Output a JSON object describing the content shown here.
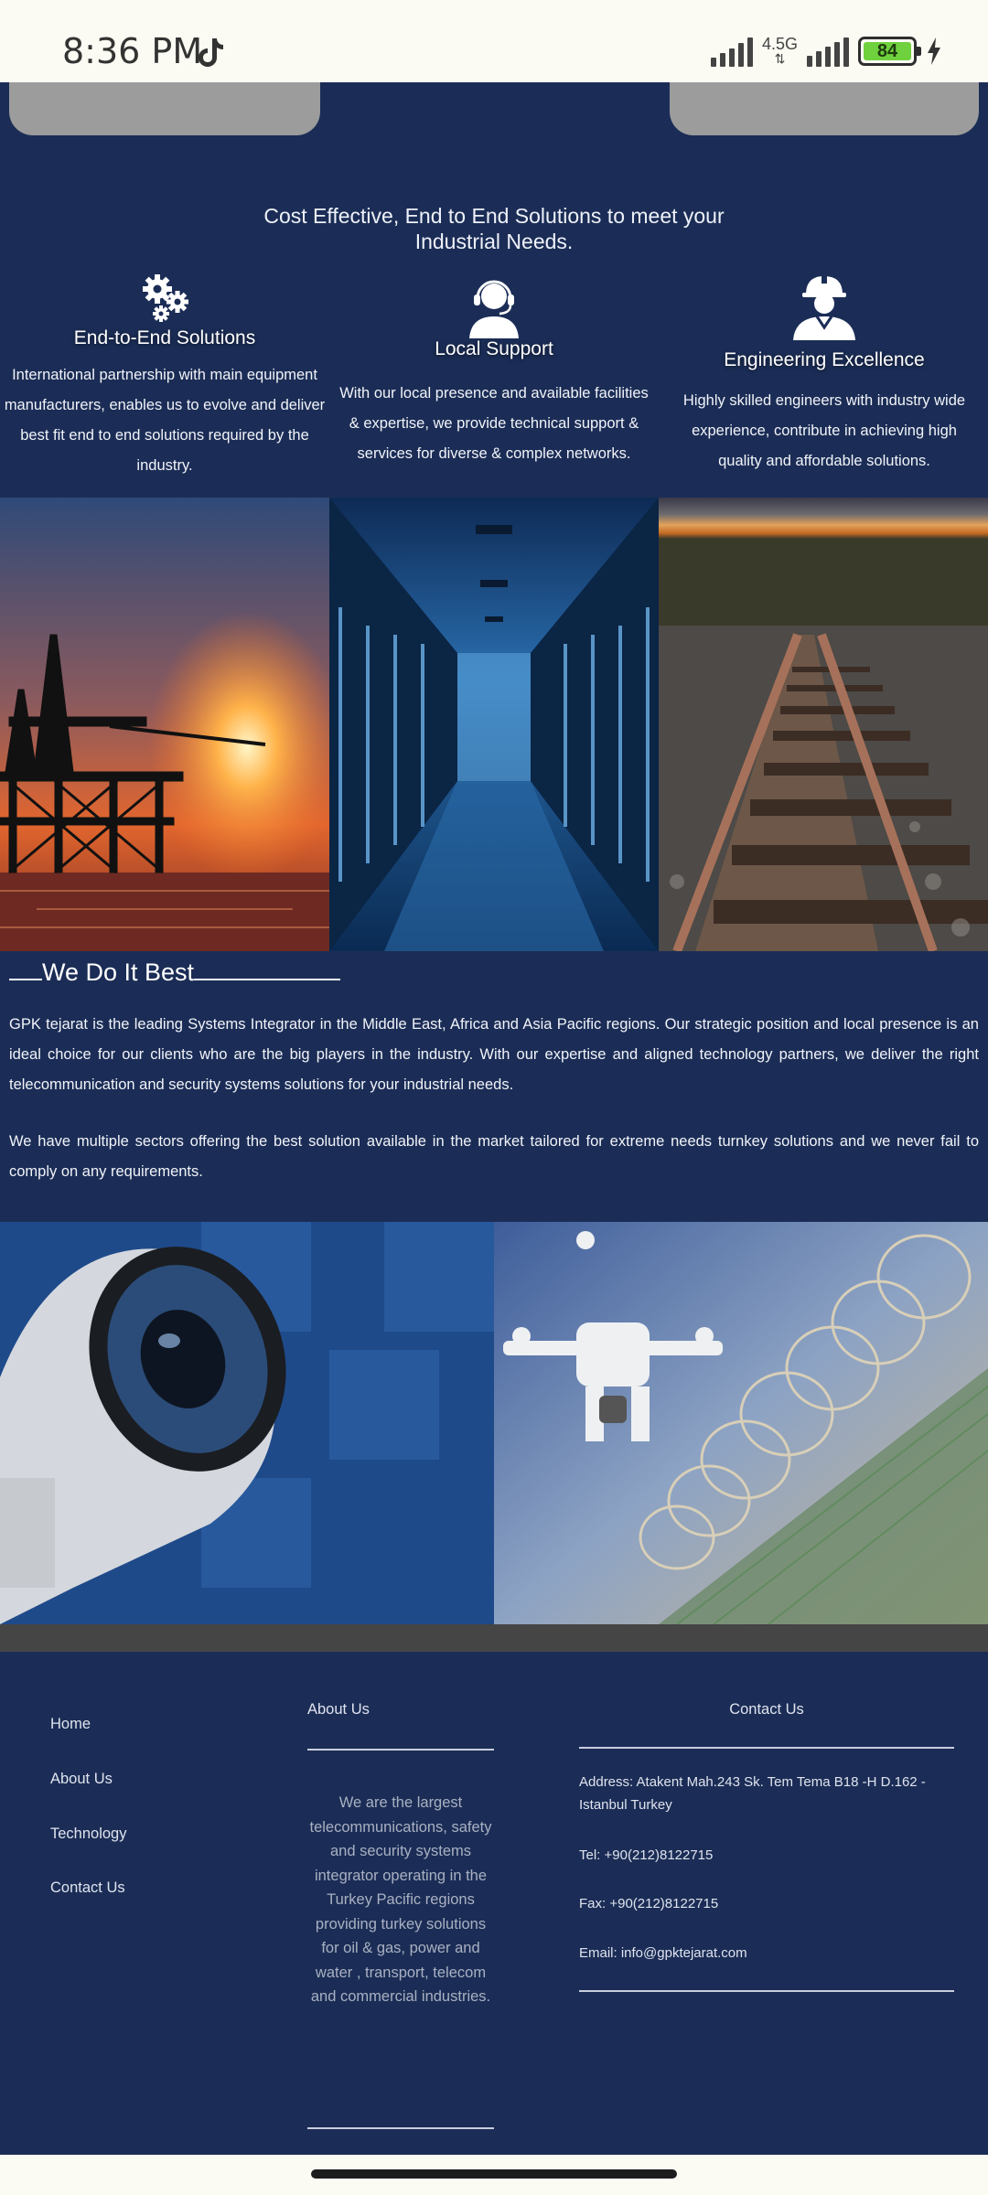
{
  "status_bar": {
    "time": "8:36 PM",
    "network": "4.5G",
    "battery": "84",
    "icons": [
      "tiktok-icon",
      "signal-icon",
      "signal-icon",
      "battery-icon",
      "charging-icon"
    ]
  },
  "intro": {
    "heading": "Cost Effective, End to End Solutions to meet your Industrial Needs."
  },
  "features": [
    {
      "icon": "gears-icon",
      "title": "End-to-End Solutions",
      "text": "International partnership with main equipment manufacturers, enables us to evolve and deliver best fit end to end solutions required by the industry."
    },
    {
      "icon": "headset-support-icon",
      "title": "Local Support",
      "text": "With our local presence and available facilities & expertise, we provide technical support & services for diverse & complex networks."
    },
    {
      "icon": "engineer-icon",
      "title": "Engineering Excellence",
      "text": "Highly skilled engineers with industry wide experience, contribute in achieving high quality and affordable solutions."
    }
  ],
  "photos": [
    "oil-rig-sunset-photo",
    "data-center-photo",
    "railway-track-photo",
    "security-camera-photo",
    "drone-fence-photo"
  ],
  "about_section": {
    "title": "We Do It Best",
    "paragraphs": [
      "GPK tejarat is the leading Systems Integrator in the Middle East, Africa and Asia Pacific regions. Our strategic position and local presence is an ideal choice for our clients who are the big players in the industry. With our expertise and aligned technology partners, we deliver the right telecommunication and security systems solutions for your industrial needs.",
      "We have multiple sectors offering the best solution available in the market tailored for extreme needs turnkey solutions and we never fail to comply on any requirements."
    ]
  },
  "footer": {
    "links": [
      "Home",
      "About Us",
      "Technology",
      "Contact Us"
    ],
    "about_title": "About Us",
    "about_text": "We are the largest telecommunications, safety and security systems integrator operating in the Turkey Pacific regions providing turkey solutions for oil & gas, power and water , transport, telecom and commercial industries.",
    "contact_title": "Contact Us",
    "address": "Address: Atakent Mah.243 Sk. Tem Tema B18 -H D.162 - Istanbul Turkey",
    "tel": "Tel: +90(212)8122715",
    "fax": "Fax: +90(212)8122715",
    "email": "Email: info@gpktejarat.com"
  },
  "colors": {
    "page_background": "#1b2d56",
    "status_bar": "#fbfbf3",
    "tab_grey": "#9c9c9c",
    "battery_green": "#6fd13d"
  }
}
